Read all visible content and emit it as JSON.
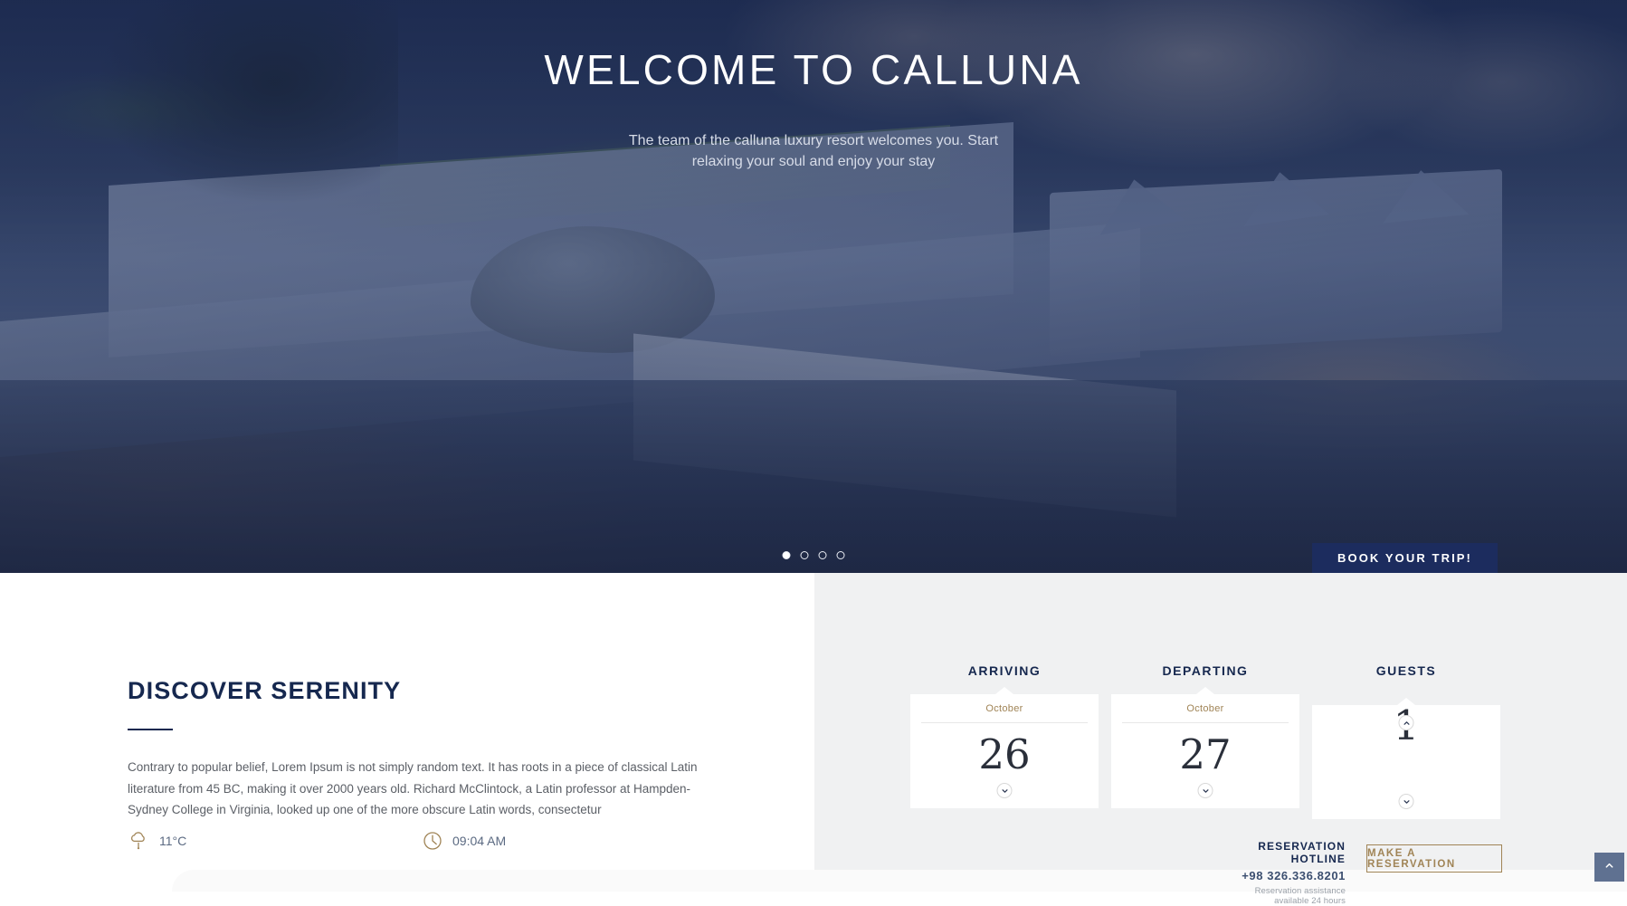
{
  "hero": {
    "title": "WELCOME TO CALLUNA",
    "subtitle": "The team of the calluna luxury resort welcomes you. Start relaxing your soul and enjoy your stay",
    "book_button": "BOOK YOUR TRIP!",
    "carousel": {
      "total": 4,
      "active_index": 0
    }
  },
  "intro": {
    "heading": "DISCOVER SERENITY",
    "paragraph": "Contrary to popular belief, Lorem Ipsum is not simply random text. It has roots in a piece of classical Latin literature from 45 BC, making it over 2000 years old. Richard McClintock, a Latin professor at Hampden-Sydney College in Virginia, looked up one of the more obscure Latin words, consectetur",
    "weather": {
      "icon": "cloud-rain-icon",
      "value": "11°C"
    },
    "time": {
      "icon": "clock-icon",
      "value": "09:04 AM"
    }
  },
  "booking": {
    "columns": [
      {
        "label": "ARRIVING",
        "month": "October",
        "value": "26",
        "has_up": false,
        "has_down": true
      },
      {
        "label": "DEPARTING",
        "month": "October",
        "value": "27",
        "has_up": false,
        "has_down": true
      },
      {
        "label": "GUESTS",
        "month": "",
        "value": "1",
        "has_up": true,
        "has_down": true
      }
    ],
    "hotline_title": "RESERVATION HOTLINE",
    "hotline_number": "+98 326.336.8201",
    "hotline_note": "Reservation assistance available 24 hours",
    "reserve_button": "MAKE A RESERVATION"
  },
  "scroll_top": {
    "icon": "chevron-up-icon"
  },
  "colors": {
    "navy": "#16284f",
    "button_navy": "#1c2c5e",
    "gold": "#a08456",
    "panel_bg": "#f0f1f2",
    "slate": "#5f7191",
    "body_text": "#5b5f66"
  }
}
